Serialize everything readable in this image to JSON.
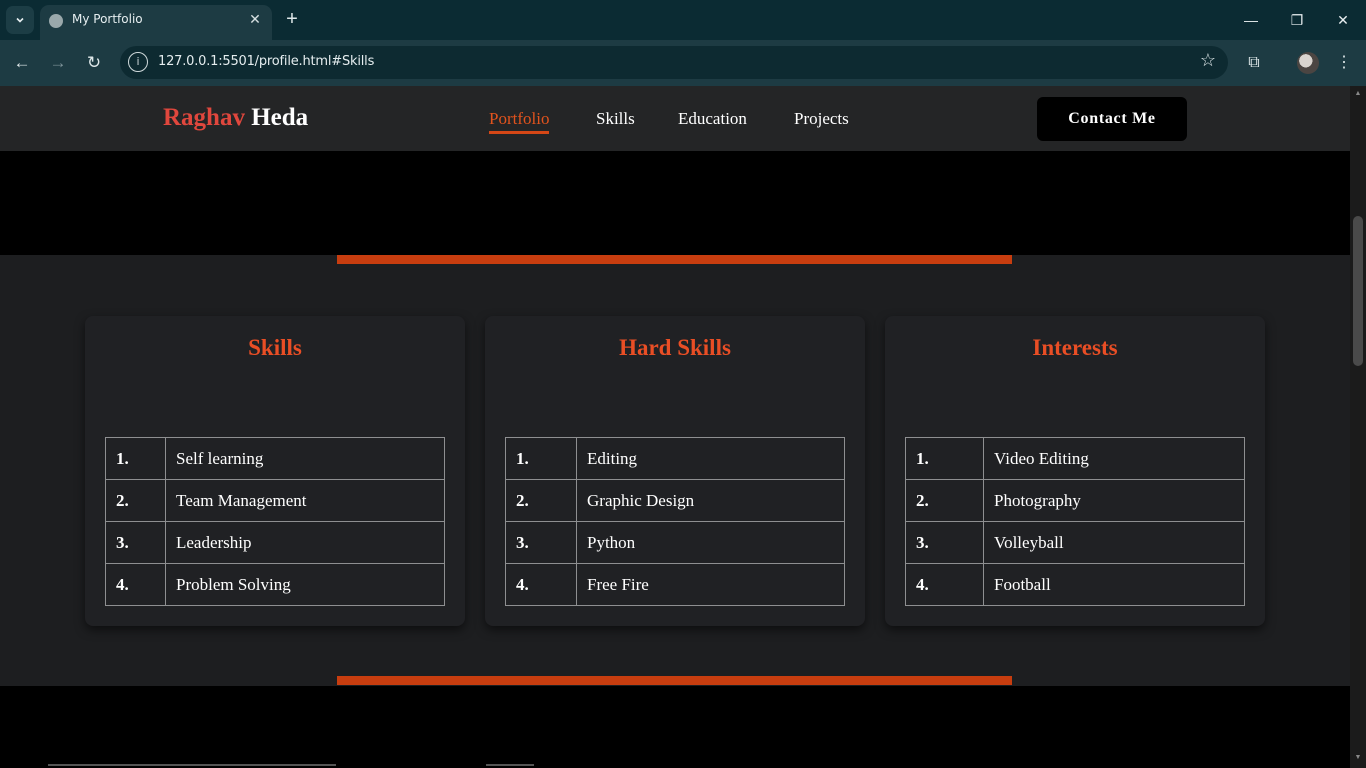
{
  "browser": {
    "tab_title": "My Portfolio",
    "url": "127.0.0.1:5501/profile.html#Skills",
    "icons": {
      "tab_menu": "chevron-down-icon",
      "favicon": "globe-icon",
      "tab_close": "close-icon",
      "new_tab": "plus-icon",
      "minimize": "minimize-icon",
      "restore": "restore-icon",
      "close": "close-icon",
      "back": "arrow-left-icon",
      "forward": "arrow-right-icon",
      "reload": "reload-icon",
      "site_info": "info-icon",
      "bookmark": "star-icon",
      "extensions": "puzzle-icon",
      "profile": "avatar",
      "menu": "kebab-menu-icon"
    }
  },
  "site": {
    "brand_first": "Raghav",
    "brand_last": "Heda",
    "nav": [
      {
        "label": "Portfolio",
        "active": true
      },
      {
        "label": "Skills",
        "active": false
      },
      {
        "label": "Education",
        "active": false
      },
      {
        "label": "Projects",
        "active": false
      }
    ],
    "contact_label": "Contact Me",
    "colors": {
      "accent": "#e94e25",
      "accent_bar": "#c73d0f",
      "nav_bg": "#242526",
      "section_bg": "#1d1e20",
      "card_bg": "#202124"
    }
  },
  "cards": [
    {
      "title": "Skills",
      "rows": [
        {
          "num": "1.",
          "text": "Self learning"
        },
        {
          "num": "2.",
          "text": "Team Management"
        },
        {
          "num": "3.",
          "text": "Leadership"
        },
        {
          "num": "4.",
          "text": "Problem Solving"
        }
      ]
    },
    {
      "title": "Hard Skills",
      "rows": [
        {
          "num": "1.",
          "text": "Editing"
        },
        {
          "num": "2.",
          "text": "Graphic Design"
        },
        {
          "num": "3.",
          "text": "Python"
        },
        {
          "num": "4.",
          "text": "Free Fire"
        }
      ]
    },
    {
      "title": "Interests",
      "rows": [
        {
          "num": "1.",
          "text": "Video Editing"
        },
        {
          "num": "2.",
          "text": "Photography"
        },
        {
          "num": "3.",
          "text": "Volleyball"
        },
        {
          "num": "4.",
          "text": "Football"
        }
      ]
    }
  ]
}
